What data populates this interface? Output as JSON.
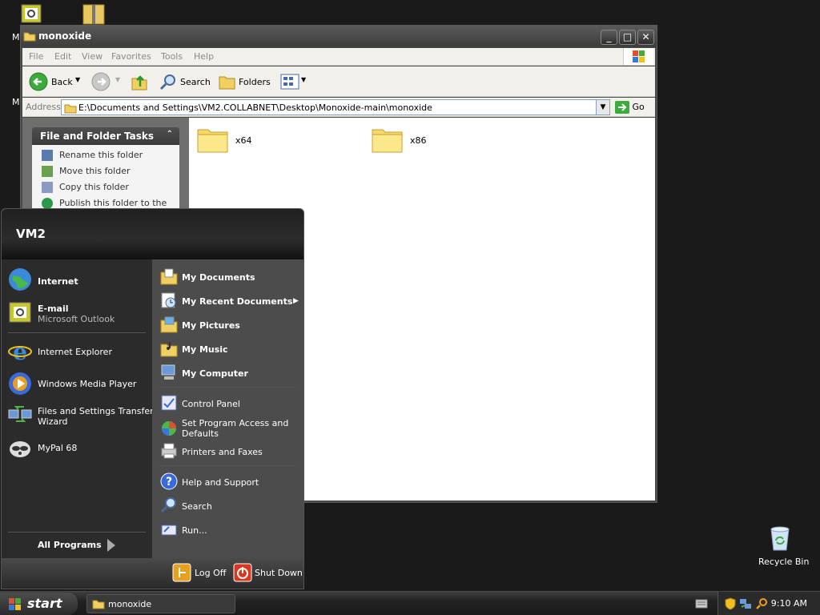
{
  "desktop": {
    "left_icon_labels": [
      "M",
      "M"
    ],
    "recycle_bin_label": "Recycle Bin"
  },
  "explorer": {
    "title": "monoxide",
    "menu": [
      "File",
      "Edit",
      "View",
      "Favorites",
      "Tools",
      "Help"
    ],
    "toolbar": {
      "back": "Back",
      "search": "Search",
      "folders": "Folders"
    },
    "address": {
      "label": "Address",
      "value": "E:\\Documents and Settings\\VM2.COLLABNET\\Desktop\\Monoxide-main\\monoxide",
      "go": "Go"
    },
    "tasks": {
      "header": "File and Folder Tasks",
      "items": [
        "Rename this folder",
        "Move this folder",
        "Copy this folder",
        "Publish this folder to the"
      ]
    },
    "folders": [
      "x64",
      "x86"
    ]
  },
  "startmenu": {
    "user": "VM2",
    "pinned": [
      {
        "label": "Internet"
      },
      {
        "label": "E-mail",
        "sub": "Microsoft Outlook"
      }
    ],
    "recent": [
      {
        "label": "Internet Explorer"
      },
      {
        "label": "Windows Media Player"
      },
      {
        "label": "Files and Settings Transfer",
        "label2": "Wizard"
      },
      {
        "label": "MyPal 68"
      }
    ],
    "all_programs": "All Programs",
    "right_top": [
      "My Documents",
      "My Recent Documents",
      "My Pictures",
      "My Music",
      "My Computer"
    ],
    "right_mid": [
      "Control Panel",
      "Set Program Access and",
      "Defaults",
      "Printers and Faxes"
    ],
    "right_bottom": [
      "Help and Support",
      "Search",
      "Run..."
    ],
    "log_off": "Log Off",
    "shut_down": "Shut Down"
  },
  "taskbar": {
    "start": "start",
    "task_button": "monoxide",
    "clock": "9:10 AM"
  },
  "colors": {
    "desktop": "#1a1a1a",
    "window_chrome": "#4a4a4a",
    "start_left": "#2b2b2b",
    "start_right": "#4c4c4c"
  }
}
